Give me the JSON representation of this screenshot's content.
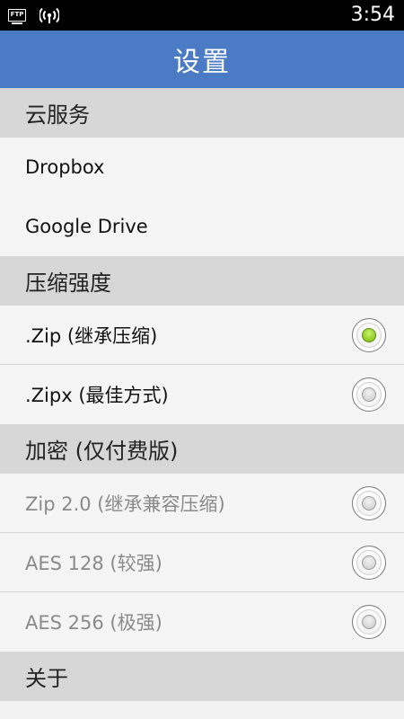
{
  "status_bar": {
    "ftp_label": "FTP",
    "time": "3:54",
    "icons": [
      "ftp-icon",
      "wifi-icon"
    ]
  },
  "header": {
    "title": "设置",
    "color": "#4a7bc4"
  },
  "sections": {
    "cloud": {
      "title": "云服务",
      "items": [
        "Dropbox",
        "Google Drive"
      ]
    },
    "compression": {
      "title": "压缩强度",
      "options": [
        {
          "label": ".Zip (继承压缩)",
          "selected": true
        },
        {
          "label": ".Zipx (最佳方式)",
          "selected": false
        }
      ]
    },
    "encryption": {
      "title": "加密 (仅付费版)",
      "options": [
        {
          "label": "Zip 2.0 (继承兼容压缩)",
          "selected": false
        },
        {
          "label": "AES 128 (较强)",
          "selected": false
        },
        {
          "label": "AES 256 (极强)",
          "selected": false
        }
      ]
    },
    "about": {
      "title": "关于"
    }
  },
  "colors": {
    "radio_selected": "#8fcc1f",
    "section_background": "#d7d7d7",
    "item_background": "#f5f5f5",
    "disabled_text": "#8a8a8a"
  }
}
